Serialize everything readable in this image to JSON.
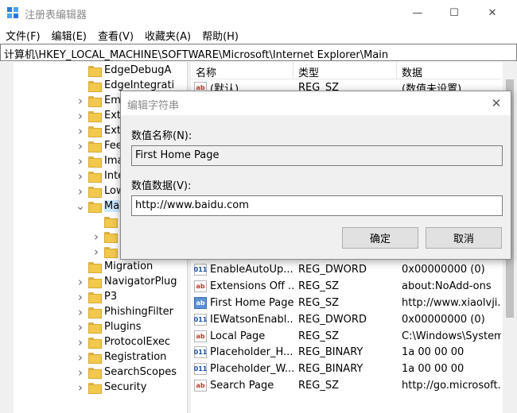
{
  "window": {
    "title": "注册表编辑器",
    "min_glyph": "—",
    "max_glyph": "☐",
    "close_glyph": "✕"
  },
  "menu": [
    "文件(F)",
    "编辑(E)",
    "查看(V)",
    "收藏夹(A)",
    "帮助(H)"
  ],
  "address": "计算机\\HKEY_LOCAL_MACHINE\\SOFTWARE\\Microsoft\\Internet Explorer\\Main",
  "tree": [
    {
      "label": "EdgeDebugA",
      "chev": "",
      "indent": 0
    },
    {
      "label": "EdgeIntegrati",
      "chev": "",
      "indent": 0
    },
    {
      "label": "Eml",
      "chev": ">",
      "indent": 0
    },
    {
      "label": "Exte",
      "chev": ">",
      "indent": 0
    },
    {
      "label": "Exte",
      "chev": ">",
      "indent": 0
    },
    {
      "label": "Fee",
      "chev": ">",
      "indent": 0
    },
    {
      "label": "Ima",
      "chev": ">",
      "indent": 0
    },
    {
      "label": "Inte",
      "chev": ">",
      "indent": 0
    },
    {
      "label": "Low",
      "chev": ">",
      "indent": 0
    },
    {
      "label": "Main",
      "chev": "v",
      "indent": 0,
      "selected": true
    },
    {
      "label": "E",
      "chev": "",
      "indent": 1
    },
    {
      "label": "F",
      "chev": ">",
      "indent": 1
    },
    {
      "label": "U",
      "chev": ">",
      "indent": 1
    },
    {
      "label": "Migration",
      "chev": "",
      "indent": 0
    },
    {
      "label": "NavigatorPlug",
      "chev": ">",
      "indent": 0
    },
    {
      "label": "P3",
      "chev": ">",
      "indent": 0
    },
    {
      "label": "PhishingFilter",
      "chev": ">",
      "indent": 0
    },
    {
      "label": "Plugins",
      "chev": ">",
      "indent": 0
    },
    {
      "label": "ProtocolExec",
      "chev": ">",
      "indent": 0
    },
    {
      "label": "Registration",
      "chev": ">",
      "indent": 0
    },
    {
      "label": "SearchScopes",
      "chev": ">",
      "indent": 0
    },
    {
      "label": "Security",
      "chev": ">",
      "indent": 0
    }
  ],
  "list": {
    "headers": [
      "名称",
      "类型",
      "数据"
    ],
    "rows": [
      {
        "name": "(默认)",
        "type": "REG_SZ",
        "data": "(数值未设置)",
        "icon": "sz",
        "icon_text": "ab"
      },
      {
        "name": "EnableAutoUp...",
        "type": "REG_DWORD",
        "data": "0x00000000 (0)",
        "icon": "bin",
        "icon_text": "011"
      },
      {
        "name": "Extensions Off ...",
        "type": "REG_SZ",
        "data": "about:NoAdd-ons",
        "icon": "sz",
        "icon_text": "ab"
      },
      {
        "name": "First Home Page",
        "type": "REG_SZ",
        "data": "http://www.xiaolvji.c",
        "icon": "sel",
        "icon_text": "ab"
      },
      {
        "name": "IEWatsonEnabl...",
        "type": "REG_DWORD",
        "data": "0x00000000 (0)",
        "icon": "bin",
        "icon_text": "011"
      },
      {
        "name": "Local Page",
        "type": "REG_SZ",
        "data": "C:\\Windows\\System",
        "icon": "sz",
        "icon_text": "ab"
      },
      {
        "name": "Placeholder_H...",
        "type": "REG_BINARY",
        "data": "1a 00 00 00",
        "icon": "bin",
        "icon_text": "011"
      },
      {
        "name": "Placeholder_W...",
        "type": "REG_BINARY",
        "data": "1a 00 00 00",
        "icon": "bin",
        "icon_text": "011"
      },
      {
        "name": "Search Page",
        "type": "REG_SZ",
        "data": "http://go.microsoft.",
        "icon": "sz",
        "icon_text": "ab"
      }
    ]
  },
  "dialog": {
    "title": "编辑字符串",
    "close_glyph": "✕",
    "name_label": "数值名称(N):",
    "name_value": "First Home Page",
    "data_label": "数值数据(V):",
    "data_value": "http://www.baidu.com",
    "ok": "确定",
    "cancel": "取消"
  }
}
